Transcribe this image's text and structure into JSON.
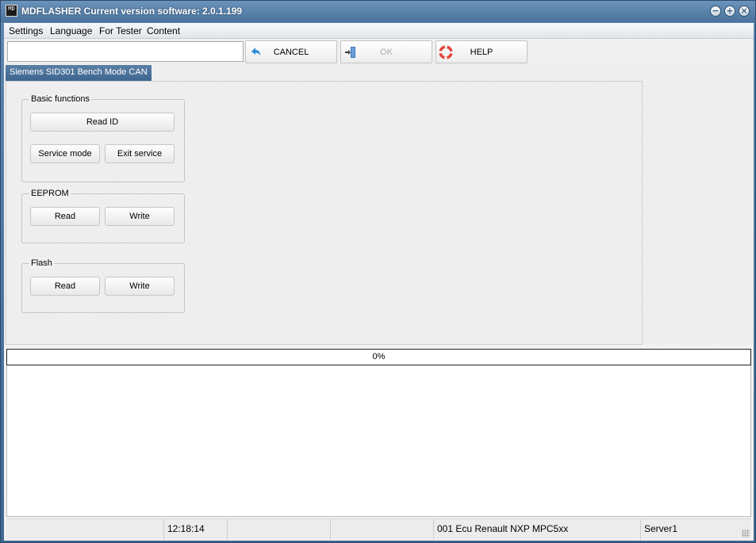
{
  "window": {
    "icon_text": "MD",
    "title": "MDFLASHER  Current version software: 2.0.1.199",
    "minimize_glyph": "−",
    "maximize_glyph": "+",
    "close_glyph": "×"
  },
  "menu": {
    "items": [
      "Settings",
      "Language",
      "For Tester",
      "Content"
    ]
  },
  "toolbar": {
    "input_value": "",
    "cancel_label": "CANCEL",
    "cancel_icon": "undo-arrow-icon",
    "ok_label": "OK",
    "ok_icon": "exit-door-icon",
    "ok_enabled": false,
    "help_label": "HELP",
    "help_icon": "lifebuoy-icon"
  },
  "tab": {
    "label": "Siemens SID301 Bench Mode CAN"
  },
  "groups": {
    "basic": {
      "title": "Basic functions",
      "read_id": "Read ID",
      "service_mode": "Service mode",
      "exit_service": "Exit service"
    },
    "eeprom": {
      "title": "EEPROM",
      "read": "Read",
      "write": "Write"
    },
    "flash": {
      "title": "Flash",
      "read": "Read",
      "write": "Write"
    }
  },
  "progress": {
    "value": 0,
    "text": "0%"
  },
  "status": {
    "cells": [
      "",
      "12:18:14",
      "",
      "",
      "001 Ecu Renault NXP MPC5xx",
      "Server1"
    ]
  },
  "colors": {
    "title_bar": "#5a82ab",
    "tab_active": "#4a7099",
    "cancel_icon": "#2e8bd6",
    "help_icon": "#e2453a"
  }
}
